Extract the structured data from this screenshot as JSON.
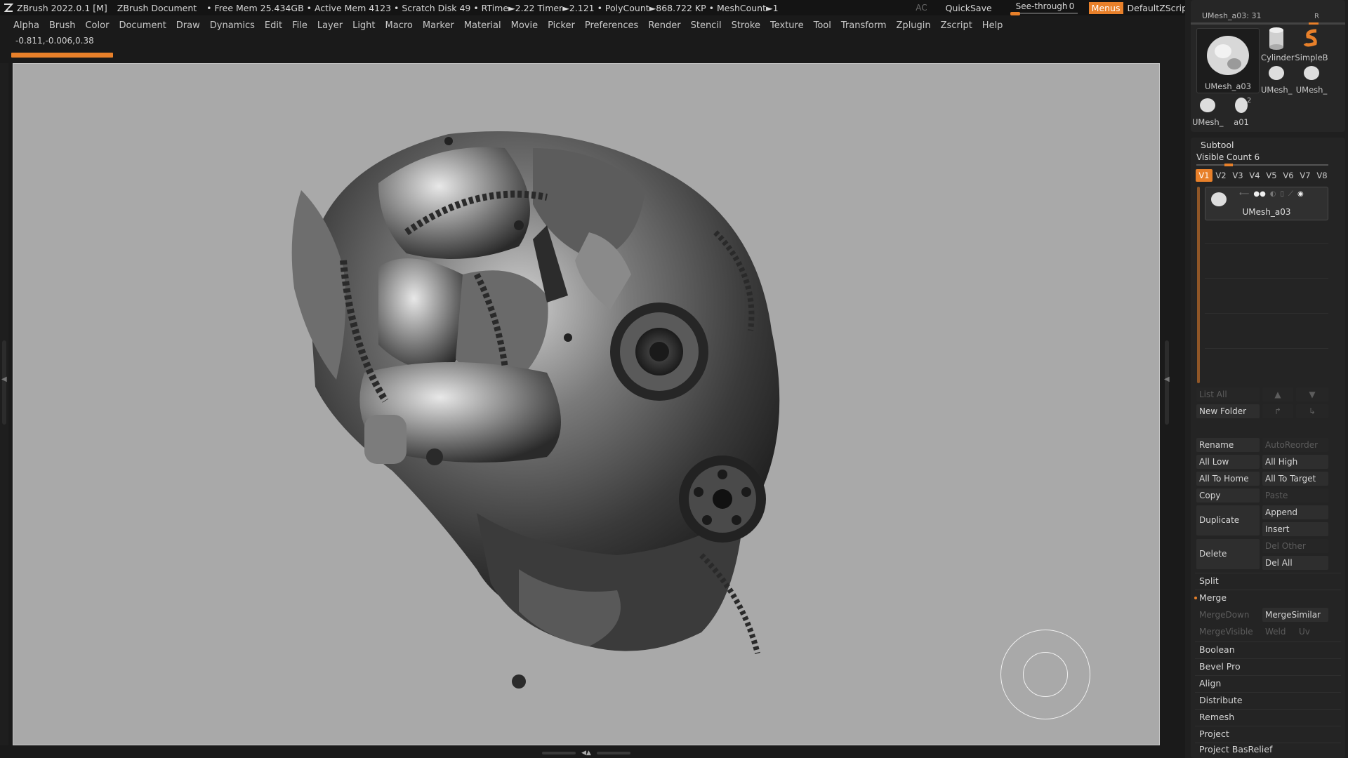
{
  "titlebar": {
    "app": "ZBrush 2022.0.1 [M]",
    "document": "ZBrush Document",
    "stats": "• Free Mem 25.434GB • Active Mem 4123 • Scratch Disk 49 •  RTime►2.22 Timer►2.121 • PolyCount►868.722 KP  • MeshCount►1",
    "ac": "AC",
    "quicksave": "QuickSave",
    "see_through_label": "See-through",
    "see_through_value": "0",
    "see_through_level": 0,
    "menus": "Menus",
    "default_zscript": "DefaultZScript",
    "accent": "#e8802a"
  },
  "menubar": [
    "Alpha",
    "Brush",
    "Color",
    "Document",
    "Draw",
    "Dynamics",
    "Edit",
    "File",
    "Layer",
    "Light",
    "Macro",
    "Marker",
    "Material",
    "Movie",
    "Picker",
    "Preferences",
    "Render",
    "Stencil",
    "Stroke",
    "Texture",
    "Tool",
    "Transform",
    "Zplugin",
    "Zscript",
    "Help"
  ],
  "coords": "-0.811,-0.006,0.38",
  "canvas": {
    "background": "#a9a9a9"
  },
  "tool": {
    "header": "UMesh_a03: 31",
    "badge": "R",
    "thumbs": [
      {
        "label": "UMesh_a03",
        "icon": "mesh-thumb-icon"
      },
      {
        "label": "Cylinder",
        "icon": "cylinder-icon"
      },
      {
        "label": "SimpleB",
        "icon": "simplebrush-icon"
      },
      {
        "label": "UMesh_",
        "icon": "mesh-thumb-icon"
      },
      {
        "label": "UMesh_",
        "icon": "mesh-thumb-icon"
      },
      {
        "label": "UMesh_",
        "icon": "mesh-thumb-icon"
      },
      {
        "label": "a01",
        "icon": "mesh-thumb-icon",
        "badge": "2"
      }
    ]
  },
  "subtool": {
    "title": "Subtool",
    "visible_count": "Visible Count 6",
    "tabs": [
      "V1",
      "V2",
      "V3",
      "V4",
      "V5",
      "V6",
      "V7",
      "V8"
    ],
    "active_tab": "V1",
    "item_label": "UMesh_a03",
    "buttons": {
      "list_all": "List All",
      "new_folder": "New Folder",
      "rename": "Rename",
      "auto_reorder": "AutoReorder",
      "all_low": "All Low",
      "all_high": "All High",
      "all_to_home": "All To Home",
      "all_to_target": "All To Target",
      "copy": "Copy",
      "paste": "Paste",
      "duplicate": "Duplicate",
      "append": "Append",
      "insert": "Insert",
      "delete": "Delete",
      "del_other": "Del Other",
      "del_all": "Del All"
    },
    "sections": {
      "split": "Split",
      "merge": "Merge",
      "merge_down": "MergeDown",
      "merge_similar": "MergeSimilar",
      "merge_visible": "MergeVisible",
      "weld": "Weld",
      "uv": "Uv",
      "boolean": "Boolean",
      "bevel_pro": "Bevel Pro",
      "align": "Align",
      "distribute": "Distribute",
      "remesh": "Remesh",
      "project": "Project",
      "project_basrelief": "Project BasRelief"
    }
  }
}
